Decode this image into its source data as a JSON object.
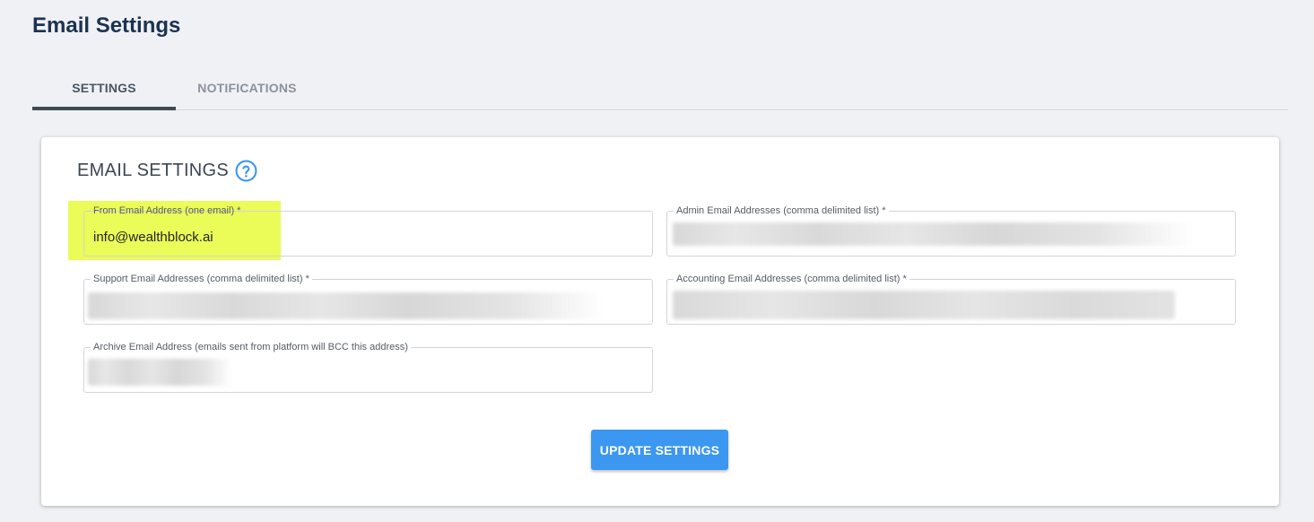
{
  "page": {
    "title": "Email Settings"
  },
  "tabs": [
    {
      "label": "SETTINGS",
      "active": true
    },
    {
      "label": "NOTIFICATIONS",
      "active": false
    }
  ],
  "card": {
    "title": "EMAIL SETTINGS",
    "help_icon": "question-circle-icon",
    "accent_color": "#3b97ef",
    "highlight_color": "#e9fb4a"
  },
  "fields": {
    "from_email": {
      "label": "From Email Address (one email) *",
      "value": "info@wealthblock.ai"
    },
    "admin_emails": {
      "label": "Admin Email Addresses (comma delimited list) *",
      "value": ""
    },
    "support_emails": {
      "label": "Support Email Addresses (comma delimited list) *",
      "value": ""
    },
    "accounting_emails": {
      "label": "Accounting Email Addresses (comma delimited list) *",
      "value": ""
    },
    "archive_email": {
      "label": "Archive Email Address (emails sent from platform will BCC this address)",
      "value": ""
    }
  },
  "actions": {
    "update_label": "UPDATE SETTINGS"
  }
}
